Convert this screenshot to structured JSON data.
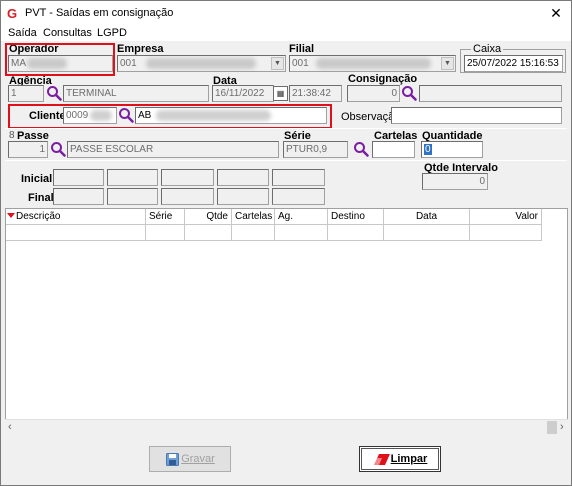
{
  "window": {
    "title": "PVT - Saídas em consignação",
    "close": "✕"
  },
  "menu": [
    {
      "label": "Saída"
    },
    {
      "label": "Consultas"
    },
    {
      "label": "LGPD"
    }
  ],
  "operador": {
    "label": "Operador",
    "value": "MA"
  },
  "empresa": {
    "label": "Empresa",
    "value": "001"
  },
  "filial": {
    "label": "Filial",
    "value": "001"
  },
  "caixa": {
    "label": "Caixa",
    "value": "25/07/2022 15:16:53"
  },
  "agencia": {
    "label": "Agência",
    "code": "1",
    "name": "TERMINAL"
  },
  "data": {
    "label": "Data",
    "date": "16/11/2022",
    "time": "21:38:42"
  },
  "consignacao": {
    "label": "Consignação",
    "value": "0"
  },
  "cliente": {
    "label": "Cliente",
    "code": "0009",
    "name": "AB"
  },
  "observacao": {
    "label": "Observação",
    "value": ""
  },
  "passe": {
    "label": "Passe",
    "number": "8",
    "code": "1",
    "name": "PASSE ESCOLAR"
  },
  "serie": {
    "label": "Série",
    "value": "PTUR0,9"
  },
  "cartelas": {
    "label": "Cartelas",
    "value": ""
  },
  "quantidade": {
    "label": "Quantidade",
    "value": "0"
  },
  "inicial": {
    "label": "Inicial"
  },
  "final": {
    "label": "Final"
  },
  "qtde_intervalo": {
    "label": "Qtde Intervalo",
    "value": "0"
  },
  "grid": {
    "columns": [
      "Descrição",
      "Série",
      "Qtde",
      "Cartelas",
      "Ag.",
      "Destino",
      "Data",
      "Valor"
    ]
  },
  "buttons": {
    "gravar": "Gravar",
    "limpar": "Limpar"
  },
  "colors": {
    "highlight": "#e0101a",
    "magnifier": "#7a1fa2"
  }
}
